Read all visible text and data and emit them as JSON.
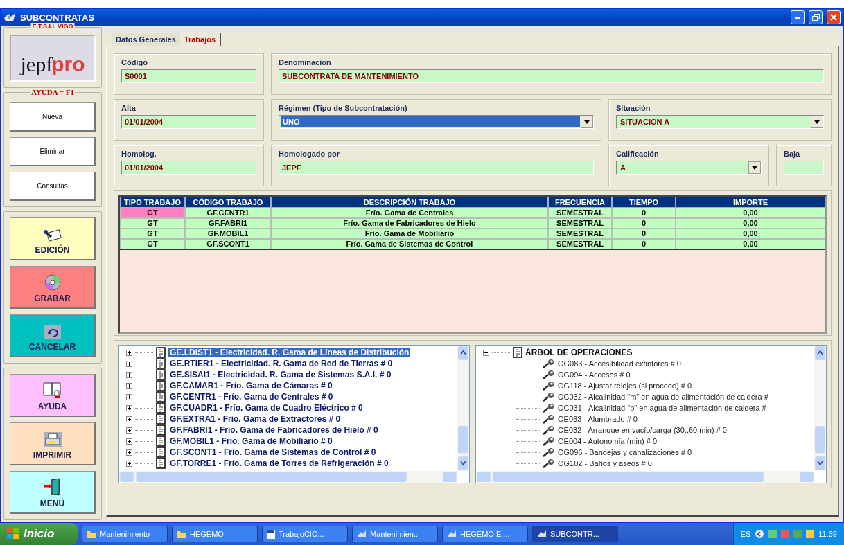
{
  "window": {
    "title": "SUBCONTRATAS"
  },
  "sidebar": {
    "group_label": "E.T.S.I.I. VIGO",
    "logo": {
      "part1": "jepf",
      "part2": "pro"
    },
    "help_label": "AYUDA = F1",
    "actions": [
      {
        "label": "Nueva"
      },
      {
        "label": "Eliminar"
      },
      {
        "label": "Consultas"
      }
    ],
    "edit_buttons": [
      {
        "label": "EDICIÓN",
        "kind": "edit",
        "color": "#ffffc0"
      },
      {
        "label": "GRABAR",
        "kind": "save",
        "color": "#ff8080"
      },
      {
        "label": "CANCELAR",
        "kind": "cancel",
        "color": "#00c0c0"
      }
    ],
    "tool_buttons": [
      {
        "label": "AYUDA",
        "kind": "help",
        "color": "#ffc0ff"
      },
      {
        "label": "IMPRIMIR",
        "kind": "print",
        "color": "#ffe0c0"
      },
      {
        "label": "MENÚ",
        "kind": "exit",
        "color": "#c0ffff"
      }
    ]
  },
  "tabs": [
    {
      "label": "Datos Generales",
      "selected": false
    },
    {
      "label": "Trabajos",
      "selected": true
    }
  ],
  "form": [
    [
      {
        "label": "Código",
        "value": "S0001",
        "kind": "text"
      },
      {
        "label": "Denominación",
        "value": "SUBCONTRATA DE MANTENIMIENTO",
        "kind": "text"
      }
    ],
    [
      {
        "label": "Alta",
        "value": "01/01/2004",
        "kind": "text"
      },
      {
        "label": "Régimen (Tipo de Subcontratación)",
        "value": "UNO",
        "kind": "select",
        "highlighted": true
      },
      {
        "label": "Situación",
        "value": "SITUACION A",
        "kind": "select",
        "highlighted": false
      }
    ],
    [
      {
        "label": "Homolog.",
        "value": "01/01/2004",
        "kind": "text"
      },
      {
        "label": "Homologado por",
        "value": "JEPF",
        "kind": "text"
      },
      {
        "label": "Calificación",
        "value": "A",
        "kind": "select",
        "highlighted": false
      },
      {
        "label": "Baja",
        "kind": "text"
      }
    ]
  ],
  "table": {
    "columns": [
      "TIPO TRABAJO",
      "CÓDIGO TRABAJO",
      "DESCRIPCIÓN TRABAJO",
      "FRECUENCIA",
      "TIEMPO",
      "IMPORTE"
    ],
    "rows": [
      {
        "cells": [
          "GT",
          "GF.CENTR1",
          "Frío. Gama de Centrales",
          "SEMESTRAL",
          "0",
          "0,00"
        ],
        "selected": true
      },
      {
        "cells": [
          "GT",
          "GF.FABRI1",
          "Frío. Gama de Fabricadores de Hielo",
          "SEMESTRAL",
          "0",
          "0,00"
        ],
        "selected": false
      },
      {
        "cells": [
          "GT",
          "GF.MOBIL1",
          "Frío. Gama de Mobiliario",
          "SEMESTRAL",
          "0",
          "0,00"
        ],
        "selected": false
      },
      {
        "cells": [
          "GT",
          "GF.SCONT1",
          "Frío. Gama de Sistemas de Control",
          "SEMESTRAL",
          "0",
          "0,00"
        ],
        "selected": false
      }
    ]
  },
  "maintenance_tree": [
    {
      "label": "GE.LDIST1 - Electricidad. R. Gama de Líneas de Distribución",
      "expanded": false,
      "selected": true
    },
    {
      "label": "GE.RTIER1 - Electricidad. R. Gama de Red de Tierras # 0",
      "expanded": false,
      "selected": false
    },
    {
      "label": "GE.SISAI1 - Electricidad. R. Gama de Sistemas S.A.I. # 0",
      "expanded": false,
      "selected": false
    },
    {
      "label": "GF.CAMAR1 - Frío. Gama de Cámaras # 0",
      "expanded": false,
      "selected": false
    },
    {
      "label": "GF.CENTR1 - Frío. Gama de Centrales # 0",
      "expanded": false,
      "selected": false
    },
    {
      "label": "GF.CUADR1 - Frío. Gama de Cuadro Eléctrico # 0",
      "expanded": false,
      "selected": false
    },
    {
      "label": "GF.EXTRA1 - Frío. Gama de Extractores # 0",
      "expanded": false,
      "selected": false
    },
    {
      "label": "GF.FABRI1 - Frío. Gama de Fabricadores de Hielo # 0",
      "expanded": false,
      "selected": false
    },
    {
      "label": "GF.MOBIL1 - Frío. Gama de Mobiliario # 0",
      "expanded": false,
      "selected": false
    },
    {
      "label": "GF.SCONT1 - Frío. Gama de Sistemas de Control # 0",
      "expanded": false,
      "selected": false
    },
    {
      "label": "GF.TORRE1 - Frío. Gama de Torres de Refrigeración # 0",
      "expanded": false,
      "selected": false
    }
  ],
  "operations_tree": {
    "label": "ÁRBOL DE OPERACIONES",
    "expanded": true,
    "children": [
      {
        "label": "OG083 - Accesibilidad extintores # 0"
      },
      {
        "label": "OG094 - Accesos # 0"
      },
      {
        "label": "OG118 - Ajustar relojes (si procede) # 0"
      },
      {
        "label": "OC032 - Alcalinidad \"m\" en agua de alimentación de caldera #"
      },
      {
        "label": "OC031 - Alcalinidad \"p\" en agua de alimentación de caldera #"
      },
      {
        "label": "OE083 - Alumbrado # 0"
      },
      {
        "label": "OE032 - Arranque en vacío/carga (30..60 min) # 0"
      },
      {
        "label": "OE004 - Autonomía (min) # 0"
      },
      {
        "label": "OG096 - Bandejas y canalizaciones # 0"
      },
      {
        "label": "OG102 - Baños y aseos # 0"
      }
    ]
  },
  "taskbar": {
    "start": "Inicio",
    "tasks": [
      {
        "label": "Mantenimiento",
        "kind": "folder",
        "selected": false
      },
      {
        "label": "HEGEMO",
        "kind": "folder",
        "selected": false
      },
      {
        "label": "TrabajoCIO...",
        "kind": "document",
        "selected": false
      },
      {
        "label": "Mantenimien...",
        "kind": "app",
        "selected": false
      },
      {
        "label": "HEGEMO E....",
        "kind": "app",
        "selected": false
      },
      {
        "label": "SUBCONTR...",
        "kind": "app",
        "selected": true
      }
    ],
    "language": "ES",
    "clock": "11:39"
  }
}
